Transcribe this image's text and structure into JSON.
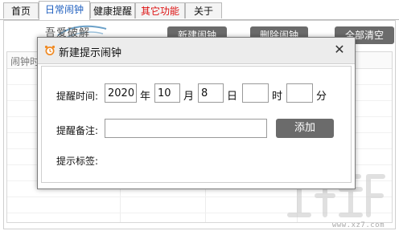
{
  "tabs": [
    {
      "label": "首页"
    },
    {
      "label": "日常闹钟"
    },
    {
      "label": "健康提醒"
    },
    {
      "label": "其它功能"
    },
    {
      "label": "关于"
    }
  ],
  "toolbar": {
    "logo_text": "吾爱破解",
    "new_alarm": "新建闹钟",
    "delete_alarm": "删除闹钟",
    "clear_all": "全部清空"
  },
  "list": {
    "first_column": "闹钟时"
  },
  "dialog": {
    "title": "新建提示闹钟",
    "time_label": "提醒时间:",
    "year_value": "2020",
    "year_unit": "年",
    "month_value": "10",
    "month_unit": "月",
    "day_value": "8",
    "day_unit": "日",
    "hour_value": "",
    "hour_unit": "时",
    "minute_value": "",
    "minute_unit": "分",
    "note_label": "提醒备注:",
    "note_value": "",
    "add_button": "添加",
    "tag_label": "提示标签:"
  },
  "colors": {
    "active_tab_text": "#1f5fbf",
    "special_tab_text": "#dd1111",
    "button_bg": "#6b6b6b",
    "dialog_title_bg": "#ececec"
  },
  "watermark": {
    "url_text": "www.xz7.com"
  }
}
